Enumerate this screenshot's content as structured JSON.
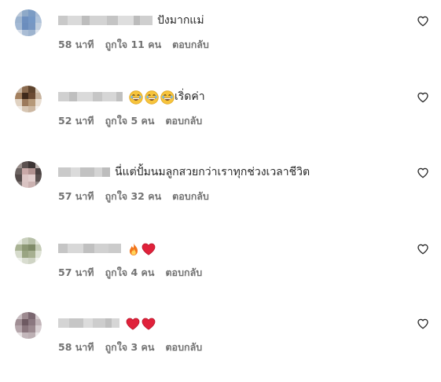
{
  "comments": [
    {
      "text": "ปังมากแม่",
      "emojis": [],
      "time": "58 นาที",
      "likes": "ถูกใจ 11 คน",
      "reply": "ตอบกลับ",
      "avatar_colors": [
        "#b9c7d8",
        "#8ea9c8",
        "#7c9cc4",
        "#a8bcd6",
        "#9db4cf",
        "#6d8fbf",
        "#7598c6",
        "#b0c3da",
        "#a3b9d4",
        "#6b8dbd",
        "#7797c3",
        "#c2cfdf",
        "#d6dee9",
        "#aabdd5",
        "#9eb4cf",
        "#dbe2ec"
      ]
    },
    {
      "text": "เริ่ดค่า",
      "emojis": [
        "grin",
        "grin",
        "grin"
      ],
      "time": "52 นาที",
      "likes": "ถูกใจ 5 คน",
      "reply": "ตอบกลับ",
      "avatar_colors": [
        "#c9b7a4",
        "#8a6a4e",
        "#5e432d",
        "#d8c9b8",
        "#a3805f",
        "#3f2a1c",
        "#6b4b33",
        "#c7b39e",
        "#e0d2c2",
        "#9c7a5c",
        "#b69979",
        "#eadfd3",
        "#f1ebe4",
        "#d7c6b3",
        "#cdb8a2",
        "#f5f1ec"
      ]
    },
    {
      "text": "นี่แต่ปั้มนมลูกสวยกว่าเราทุกช่วงเวลาชีวิต",
      "emojis": [],
      "time": "57 นาที",
      "likes": "ถูกใจ 32 คน",
      "reply": "ตอบกลับ",
      "avatar_colors": [
        "#9a8f8c",
        "#5b5150",
        "#3d3535",
        "#b8aeab",
        "#6c6361",
        "#c9a9a8",
        "#b19391",
        "#4a4242",
        "#544b4a",
        "#dcc6c5",
        "#e2cfce",
        "#5a5150",
        "#7c7372",
        "#d9c3c2",
        "#cbb2b1",
        "#8e8584"
      ]
    },
    {
      "text": "",
      "emojis": [
        "fire",
        "heart"
      ],
      "time": "57 นาที",
      "likes": "ถูกใจ 4 คน",
      "reply": "ตอบกลับ",
      "avatar_colors": [
        "#e8ebe2",
        "#c9d0bd",
        "#b7c0a8",
        "#e2e6da",
        "#a9b394",
        "#8c9874",
        "#7f8b68",
        "#c4cbb6",
        "#d6dbcc",
        "#9aa583",
        "#a7b091",
        "#dfe3d6",
        "#eef0ea",
        "#d9ddd0",
        "#cfd4c4",
        "#f3f4ef"
      ]
    },
    {
      "text": "",
      "emojis": [
        "heart",
        "heart"
      ],
      "time": "58 นาที",
      "likes": "ถูกใจ 3 คน",
      "reply": "ตอบกลับ",
      "avatar_colors": [
        "#c8bdc1",
        "#9d8a90",
        "#7b6770",
        "#d5cbce",
        "#a08e94",
        "#6e5a62",
        "#8b7880",
        "#c1b4b8",
        "#b5a6ab",
        "#8a767d",
        "#9c8a90",
        "#d8cfd2",
        "#e6e0e2",
        "#c3b7bb",
        "#bdb0b4",
        "#ece8e9"
      ]
    }
  ]
}
